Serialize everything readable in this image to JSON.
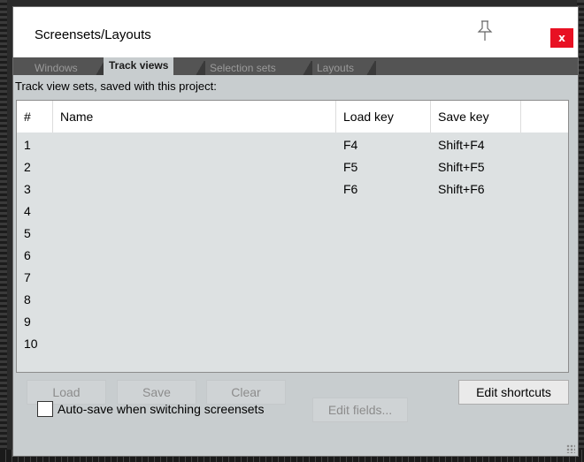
{
  "window": {
    "title": "Screensets/Layouts",
    "close_label": "x"
  },
  "tabs": [
    {
      "label": "Windows",
      "active": false
    },
    {
      "label": "Track views",
      "active": true
    },
    {
      "label": "Selection sets",
      "active": false
    },
    {
      "label": "Layouts",
      "active": false
    }
  ],
  "panel": {
    "subtitle": "Track view sets, saved with this project:"
  },
  "table": {
    "columns": [
      "#",
      "Name",
      "Load key",
      "Save key"
    ],
    "rows": [
      {
        "num": "1",
        "name": "",
        "load": "F4",
        "save": "Shift+F4"
      },
      {
        "num": "2",
        "name": "",
        "load": "F5",
        "save": "Shift+F5"
      },
      {
        "num": "3",
        "name": "",
        "load": "F6",
        "save": "Shift+F6"
      },
      {
        "num": "4",
        "name": "",
        "load": "",
        "save": ""
      },
      {
        "num": "5",
        "name": "",
        "load": "",
        "save": ""
      },
      {
        "num": "6",
        "name": "",
        "load": "",
        "save": ""
      },
      {
        "num": "7",
        "name": "",
        "load": "",
        "save": ""
      },
      {
        "num": "8",
        "name": "",
        "load": "",
        "save": ""
      },
      {
        "num": "9",
        "name": "",
        "load": "",
        "save": ""
      },
      {
        "num": "10",
        "name": "",
        "load": "",
        "save": ""
      }
    ]
  },
  "buttons": {
    "load": "Load",
    "save": "Save",
    "clear": "Clear",
    "edit_shortcuts": "Edit shortcuts",
    "edit_fields": "Edit fields..."
  },
  "autosave": {
    "label": "Auto-save when switching screensets",
    "checked": false
  },
  "colors": {
    "close_bg": "#e81123",
    "client_bg": "#c8cdcf",
    "tabbar_bg": "#545454"
  },
  "icons": {
    "pin": "pin-icon",
    "close": "close-icon",
    "grip": "resize-grip-icon"
  }
}
